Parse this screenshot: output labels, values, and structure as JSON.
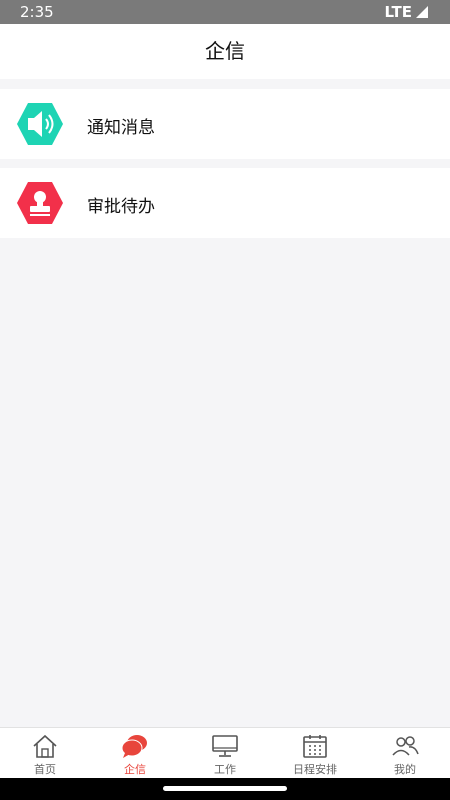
{
  "status": {
    "time": "2:35",
    "network": "LTE"
  },
  "header": {
    "title": "企信"
  },
  "list": [
    {
      "label": "通知消息",
      "icon": "speaker-icon",
      "color": "#1ed4b4"
    },
    {
      "label": "审批待办",
      "icon": "stamp-icon",
      "color": "#f2304a"
    }
  ],
  "tabs": [
    {
      "label": "首页",
      "icon": "home-icon",
      "active": false
    },
    {
      "label": "企信",
      "icon": "chat-icon",
      "active": true
    },
    {
      "label": "工作",
      "icon": "monitor-icon",
      "active": false
    },
    {
      "label": "日程安排",
      "icon": "calendar-icon",
      "active": false
    },
    {
      "label": "我的",
      "icon": "users-icon",
      "active": false
    }
  ],
  "colors": {
    "accent": "#e8453c",
    "background": "#f5f5f7"
  }
}
